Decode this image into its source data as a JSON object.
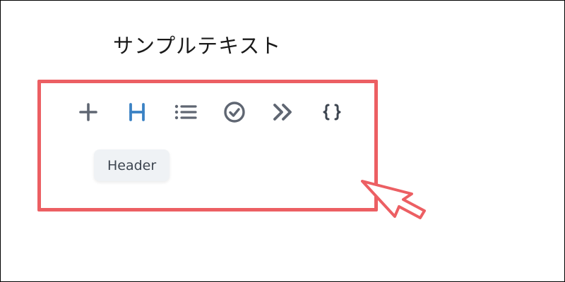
{
  "heading": {
    "text": "サンプルテキスト"
  },
  "toolbar": {
    "items": [
      {
        "name": "plus",
        "icon": "plus-icon",
        "active": false
      },
      {
        "name": "header",
        "icon": "header-icon",
        "active": true
      },
      {
        "name": "list",
        "icon": "list-icon",
        "active": false
      },
      {
        "name": "checklist",
        "icon": "check-circle-icon",
        "active": false
      },
      {
        "name": "quote",
        "icon": "double-chevron-right-icon",
        "active": false
      },
      {
        "name": "code",
        "icon": "curly-braces-icon",
        "active": false
      }
    ],
    "header_glyph": "H",
    "code_glyph": "{ }"
  },
  "tooltip": {
    "text": "Header"
  },
  "colors": {
    "highlight": "#ec5f63",
    "icon": "#6b7280",
    "icon_active": "#3b82c4",
    "tooltip_bg": "#eff2f5",
    "cursor": "#ec5f63"
  }
}
